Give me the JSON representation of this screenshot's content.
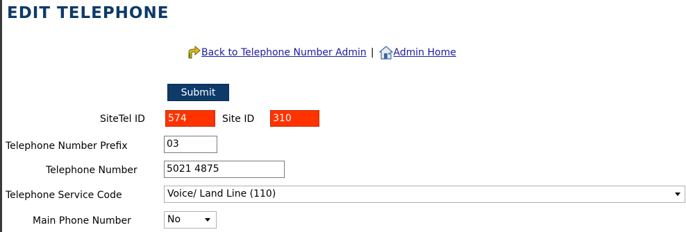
{
  "page": {
    "title": "EDIT TELEPHONE"
  },
  "nav": {
    "back_link": "Back to Telephone Number Admin",
    "separator": "|",
    "home_link": "Admin Home"
  },
  "form": {
    "submit_label": "Submit",
    "sitetel_id": {
      "label": "SiteTel ID",
      "value": "574"
    },
    "site_id": {
      "label": "Site ID",
      "value": "310"
    },
    "prefix": {
      "label": "Telephone Number Prefix",
      "value": "03"
    },
    "number": {
      "label": "Telephone Number",
      "value": "5021 4875"
    },
    "service_code": {
      "label": "Telephone Service Code",
      "selected": "Voice/ Land Line (110)"
    },
    "main_phone": {
      "label": "Main Phone Number",
      "selected": "No"
    }
  },
  "colors": {
    "title": "#0d3a68",
    "button": "#0e3a6a",
    "readonly_field": "#ff3300",
    "link": "#1a1aa6"
  }
}
